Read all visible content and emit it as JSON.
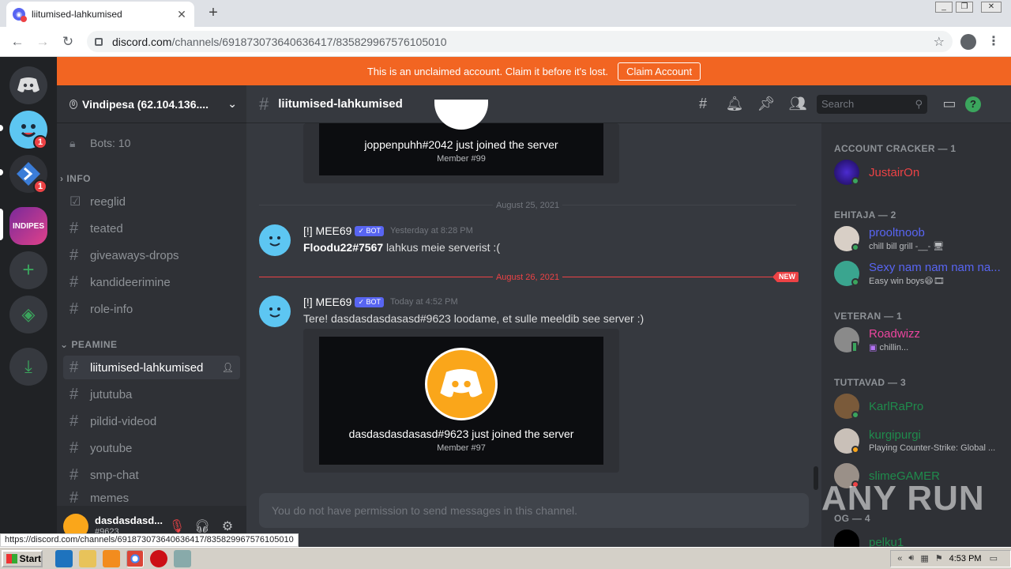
{
  "browser": {
    "tab_title": "liitumised-lahkumised",
    "url_domain": "discord.com",
    "url_path": "/channels/691873073640636417/835829967576105010",
    "status_url": "https://discord.com/channels/691873073640636417/835829967576105010"
  },
  "banner": {
    "text": "This is an unclaimed account. Claim it before it's lost.",
    "button": "Claim Account"
  },
  "guilds": {
    "badge1": "1",
    "badge2": "1",
    "server_label": "INDIPES"
  },
  "server": {
    "name": "Vindipesa (62.104.136....",
    "boost": "0"
  },
  "channels": {
    "bots": "Bots: 10",
    "cat_info": "INFO",
    "cat_peamine": "PEAMINE",
    "items": [
      "reeglid",
      "teated",
      "giveaways-drops",
      "kandideerimine",
      "role-info",
      "liitumised-lahkumised",
      "jututuba",
      "pildid-videod",
      "youtube",
      "smp-chat",
      "memes"
    ]
  },
  "user": {
    "name": "dasdasdasd...",
    "tag": "#9623"
  },
  "channel_header": {
    "name": "liitumised-lahkumised",
    "search": "Search"
  },
  "messages": {
    "embed1_text": "joppenpuhh#2042 just joined the server",
    "embed1_member": "Member #99",
    "date1": "August 25, 2021",
    "m1_author": "[!] MEE69",
    "bot_tag": "✓ BOT",
    "m1_time": "Yesterday at 8:28 PM",
    "m1_user": "Floodu22#7567",
    "m1_text": " lahkus meie serverist :(",
    "date2": "August 26, 2021",
    "new_label": "NEW",
    "m2_author": "[!] MEE69",
    "m2_time": "Today at 4:52 PM",
    "m2_text": "Tere! dasdasdasdasasd#9623 loodame, et sulle meeldib see server :)",
    "embed2_text": "dasdasdasdasasd#9623 just joined the server",
    "embed2_member": "Member #97",
    "composer": "You do not have permission to send messages in this channel."
  },
  "members": {
    "cat1": "ACCOUNT CRACKER — 1",
    "cat2": "EHITAJA — 2",
    "cat3": "VETERAN — 1",
    "cat4": "TUTTAVAD — 3",
    "cat5": "OG — 4",
    "m1": "JustairOn",
    "m2": "prooltnoob",
    "m2_status": "chill bill grill -__- 🖥",
    "m3": "Sexy nam nam nam na...",
    "m3_status": "Easy win boys😄🎞",
    "m4": "Roadwizz",
    "m4_status": "chillin...",
    "m5": "KarlRaPro",
    "m6": "kurgipurgi",
    "m6_status": "Playing Counter-Strike: Global ...",
    "m7": "slimeGAMER",
    "m8": "pelku1"
  },
  "colors": {
    "m1": "#ed4245",
    "m2": "#5865f2",
    "m3": "#5865f2",
    "m4": "#eb459e",
    "m5": "#1f8b4c",
    "m6": "#1f8b4c",
    "m7": "#1f8b4c",
    "m8": "#1f8b4c"
  },
  "watermark": "ANY RUN",
  "taskbar": {
    "start": "Start",
    "clock": "4:53 PM"
  }
}
